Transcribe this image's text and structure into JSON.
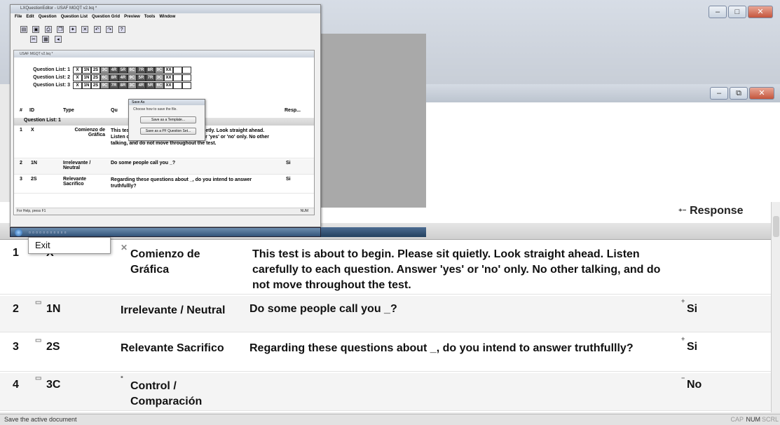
{
  "status_text": "Save the active document",
  "status_indicators": [
    "CAP",
    "NUM",
    "SCRL"
  ],
  "exit_label": "Exit",
  "big_table": {
    "response_header": "Response",
    "rows": [
      {
        "num": "1",
        "id": "X",
        "type": "Comienzo de Gráfica",
        "question": "This test is about to begin. Please sit quietly. Look straight ahead. Listen carefully to each question. Answer 'yes' or 'no' only. No other talking, and do not move throughout the test.",
        "response": ""
      },
      {
        "num": "2",
        "id": "1N",
        "type": "Irrelevante / Neutral",
        "question": "Do some people call you _?",
        "response": "Si"
      },
      {
        "num": "3",
        "id": "2S",
        "type": "Relevante Sacrifico",
        "question": "Regarding these questions about _, do you intend to answer truthfullly?",
        "response": "Si"
      },
      {
        "num": "4",
        "id": "3C",
        "type": "Control / Comparación",
        "question": "",
        "response": "No"
      }
    ]
  },
  "small_window": {
    "title": "LXQuestionEditor - USAF MGQT v2.lxq *",
    "menu": [
      "File",
      "Edit",
      "Question",
      "Question List",
      "Question Grid",
      "Preview",
      "Tools",
      "Window"
    ],
    "inner_title": "USAF MGQT v2.lxq *",
    "question_lists": [
      {
        "label": "Question List: 1",
        "cells": [
          "X",
          "1N",
          "2S",
          "3C",
          "4R",
          "5R",
          "6C",
          "7R",
          "8R",
          "9C",
          "XX",
          "",
          ""
        ]
      },
      {
        "label": "Question List: 2",
        "cells": [
          "X",
          "1N",
          "2S",
          "6C",
          "8R",
          "4R",
          "9C",
          "5R",
          "7R",
          "3C",
          "XX",
          "",
          ""
        ]
      },
      {
        "label": "Question List: 3",
        "cells": [
          "X",
          "1N",
          "2S",
          "9C",
          "7R",
          "8R",
          "3C",
          "4R",
          "5R",
          "6C",
          "XX",
          "",
          ""
        ]
      }
    ],
    "headers": {
      "num": "#",
      "id": "ID",
      "type": "Type",
      "question": "Qu",
      "response": "Resp..."
    },
    "group_label": "Question List: 1",
    "rows": [
      {
        "num": "1",
        "id": "X",
        "type": "Comienzo de Gráfica",
        "question": "This test is about to begin. Please sit quietly. Look straight ahead. Listen carefully to each question. Answer 'yes' or 'no' only. No other talking, and do not move throughout the test.",
        "response": ""
      },
      {
        "num": "2",
        "id": "1N",
        "type": "Irrelevante / Neutral",
        "question": "Do some people call you _?",
        "response": "Si"
      },
      {
        "num": "3",
        "id": "2S",
        "type": "Relevante Sacrifico",
        "question": "Regarding these questions about _, do you intend to answer truthfullly?",
        "response": "Si"
      }
    ],
    "status_left": "For Help, press F1",
    "status_right": "NUM"
  },
  "save_dialog": {
    "title": "Save As",
    "prompt": "Choose how to save the file.",
    "btn_template": "Save as a Template...",
    "btn_pf": "Save as a PF Question Set..."
  },
  "colors": {
    "dark_cell": "#555555",
    "mid_cell": "#999999",
    "taskbar": "#33547a"
  }
}
